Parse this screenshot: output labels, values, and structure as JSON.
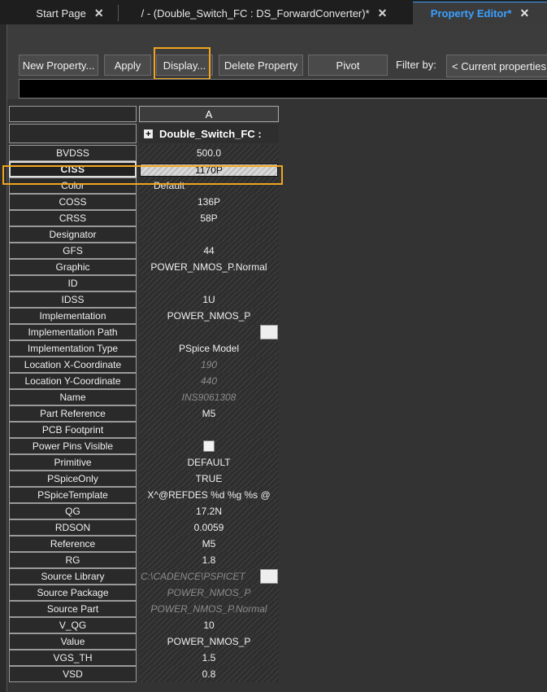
{
  "tabs": [
    {
      "label": "Start Page",
      "close": "✕"
    },
    {
      "label": "/ - (Double_Switch_FC : DS_ForwardConverter)*",
      "close": "✕"
    },
    {
      "label": "Property Editor*",
      "close": "✕"
    }
  ],
  "toolbar": {
    "new_property": "New Property...",
    "apply": "Apply",
    "display": "Display...",
    "delete_property": "Delete Property",
    "pivot": "Pivot",
    "filter_label": "Filter by:",
    "filter_value": "< Current properties"
  },
  "grid": {
    "column_header": "A",
    "instance_header": "Double_Switch_FC :",
    "rows": [
      {
        "name": "BVDSS",
        "value": "500.0"
      },
      {
        "name": "CISS",
        "value": "1170P"
      },
      {
        "name": "Color",
        "value": "Default"
      },
      {
        "name": "COSS",
        "value": "136P"
      },
      {
        "name": "CRSS",
        "value": "58P"
      },
      {
        "name": "Designator",
        "value": ""
      },
      {
        "name": "GFS",
        "value": "44"
      },
      {
        "name": "Graphic",
        "value": "POWER_NMOS_P.Normal"
      },
      {
        "name": "ID",
        "value": ""
      },
      {
        "name": "IDSS",
        "value": "1U"
      },
      {
        "name": "Implementation",
        "value": "POWER_NMOS_P"
      },
      {
        "name": "Implementation Path",
        "value": ""
      },
      {
        "name": "Implementation Type",
        "value": "PSpice Model"
      },
      {
        "name": "Location X-Coordinate",
        "value": "190"
      },
      {
        "name": "Location Y-Coordinate",
        "value": "440"
      },
      {
        "name": "Name",
        "value": "INS9061308"
      },
      {
        "name": "Part Reference",
        "value": "M5"
      },
      {
        "name": "PCB Footprint",
        "value": ""
      },
      {
        "name": "Power Pins Visible",
        "value": ""
      },
      {
        "name": "Primitive",
        "value": "DEFAULT"
      },
      {
        "name": "PSpiceOnly",
        "value": "TRUE"
      },
      {
        "name": "PSpiceTemplate",
        "value": "X^@REFDES %d %g %s @"
      },
      {
        "name": "QG",
        "value": "17.2N"
      },
      {
        "name": "RDSON",
        "value": "0.0059"
      },
      {
        "name": "Reference",
        "value": "M5"
      },
      {
        "name": "RG",
        "value": "1.8"
      },
      {
        "name": "Source Library",
        "value": "C:\\CADENCE\\PSPICET"
      },
      {
        "name": "Source Package",
        "value": "POWER_NMOS_P"
      },
      {
        "name": "Source Part",
        "value": "POWER_NMOS_P.Normal"
      },
      {
        "name": "V_QG",
        "value": "10"
      },
      {
        "name": "Value",
        "value": "POWER_NMOS_P"
      },
      {
        "name": "VGS_TH",
        "value": "1.5"
      },
      {
        "name": "VSD",
        "value": "0.8"
      }
    ]
  }
}
